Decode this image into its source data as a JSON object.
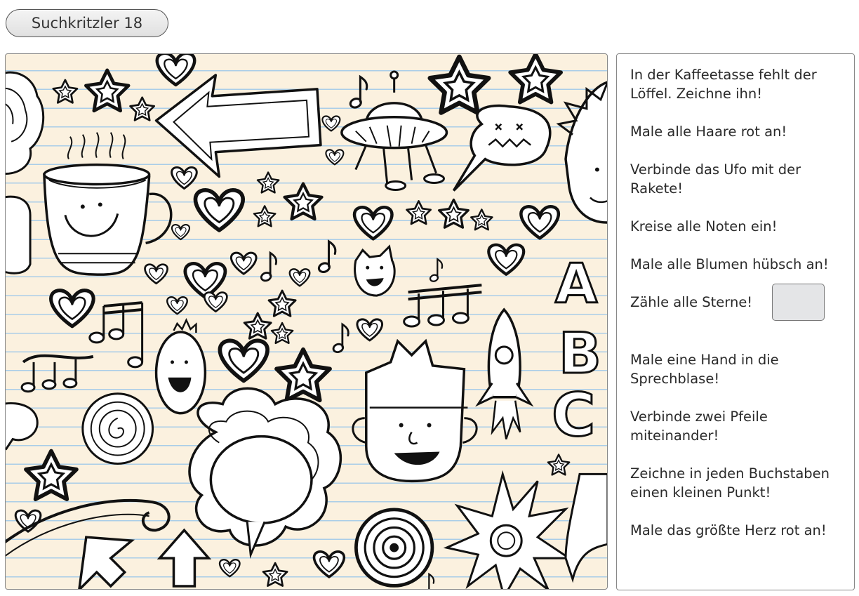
{
  "header": {
    "title": "Suchkritzler 18"
  },
  "tasks": [
    {
      "text": "In der Kaffeetasse fehlt der Löffel. Zeichne ihn!"
    },
    {
      "text": "Male alle Haare rot an!"
    },
    {
      "text": "Verbinde das Ufo mit der Rakete!"
    },
    {
      "text": "Kreise alle Noten ein!"
    },
    {
      "text": "Male alle Blumen hübsch an!"
    },
    {
      "text": "Zähle alle Sterne!"
    },
    {
      "text": "Male eine Hand in die Sprechblase!"
    },
    {
      "text": "Verbinde zwei Pfeile miteinander!"
    },
    {
      "text": "Zeichne in jeden Buchstaben einen kleinen Punkt!"
    },
    {
      "text": "Male das größte Herz rot an!"
    }
  ],
  "picture": {
    "letters": [
      "A",
      "B",
      "C"
    ],
    "colors": {
      "paper": "#fbf1df",
      "lines": "#a9cde8",
      "ink": "#111111",
      "answer_box": "#e4e5e7"
    }
  }
}
